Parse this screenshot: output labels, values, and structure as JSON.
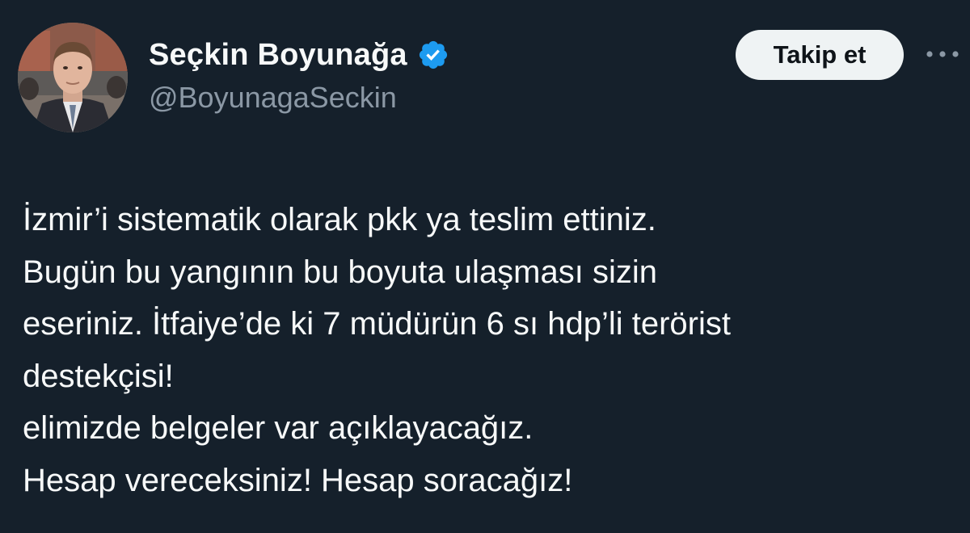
{
  "author": {
    "display_name": "Seçkin Boyunağa",
    "handle": "@BoyunagaSeckin",
    "verified_badge_icon": "verified-badge-icon",
    "verified_badge_color": "#1d9bf0"
  },
  "actions": {
    "follow_label": "Takip et",
    "more_icon": "more-horizontal-icon"
  },
  "tweet": {
    "lines": [
      "İzmir’i sistematik olarak pkk ya teslim ettiniz.",
      "Bugün bu yangının bu boyuta ulaşması sizin",
      "eseriniz. İtfaiye’de ki 7 müdürün 6 sı hdp’li terörist",
      "destekçisi!",
      "elimizde belgeler var açıklayacağız.",
      "Hesap vereceksiniz! Hesap soracağız!"
    ]
  },
  "colors": {
    "background": "#15202b",
    "text_primary": "#f7f9f9",
    "text_secondary": "#8b98a5",
    "follow_button_bg": "#eff3f4"
  }
}
